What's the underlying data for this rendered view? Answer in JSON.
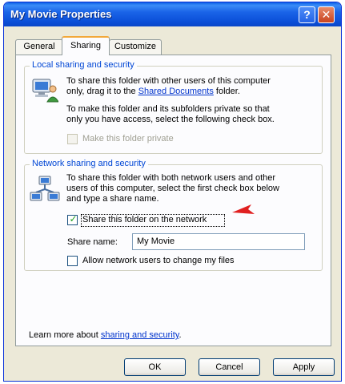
{
  "window": {
    "title": "My Movie Properties",
    "help_glyph": "?",
    "close_glyph": "✕"
  },
  "tabs": [
    {
      "label": "General"
    },
    {
      "label": "Sharing"
    },
    {
      "label": "Customize"
    }
  ],
  "local": {
    "legend": "Local sharing and security",
    "line1": "To share this folder with other users of this computer",
    "line2_pre": "only, drag it to the ",
    "line2_link": "Shared Documents",
    "line2_post": " folder.",
    "private_line1": "To make this folder and its subfolders private so that",
    "private_line2": "only you have access, select the following check box.",
    "make_private_label": "Make this folder private"
  },
  "network": {
    "legend": "Network sharing and security",
    "line1": "To share this folder with both network users and other",
    "line2": "users of this computer, select the first check box below",
    "line3": "and type a share name.",
    "share_label": "Share this folder on the network",
    "share_checked": true,
    "share_name_label": "Share name:",
    "share_name_value": "My Movie",
    "allow_change_label": "Allow network users to change my files"
  },
  "learn_more": {
    "prefix": "Learn more about ",
    "link": "sharing and security",
    "suffix": "."
  },
  "buttons": {
    "ok": "OK",
    "cancel": "Cancel",
    "apply": "Apply"
  },
  "colors": {
    "titlebar": "#0a5fe6",
    "legend_text": "#0046d5",
    "link": "#0033cc",
    "annotation_arrow": "#e02020"
  }
}
